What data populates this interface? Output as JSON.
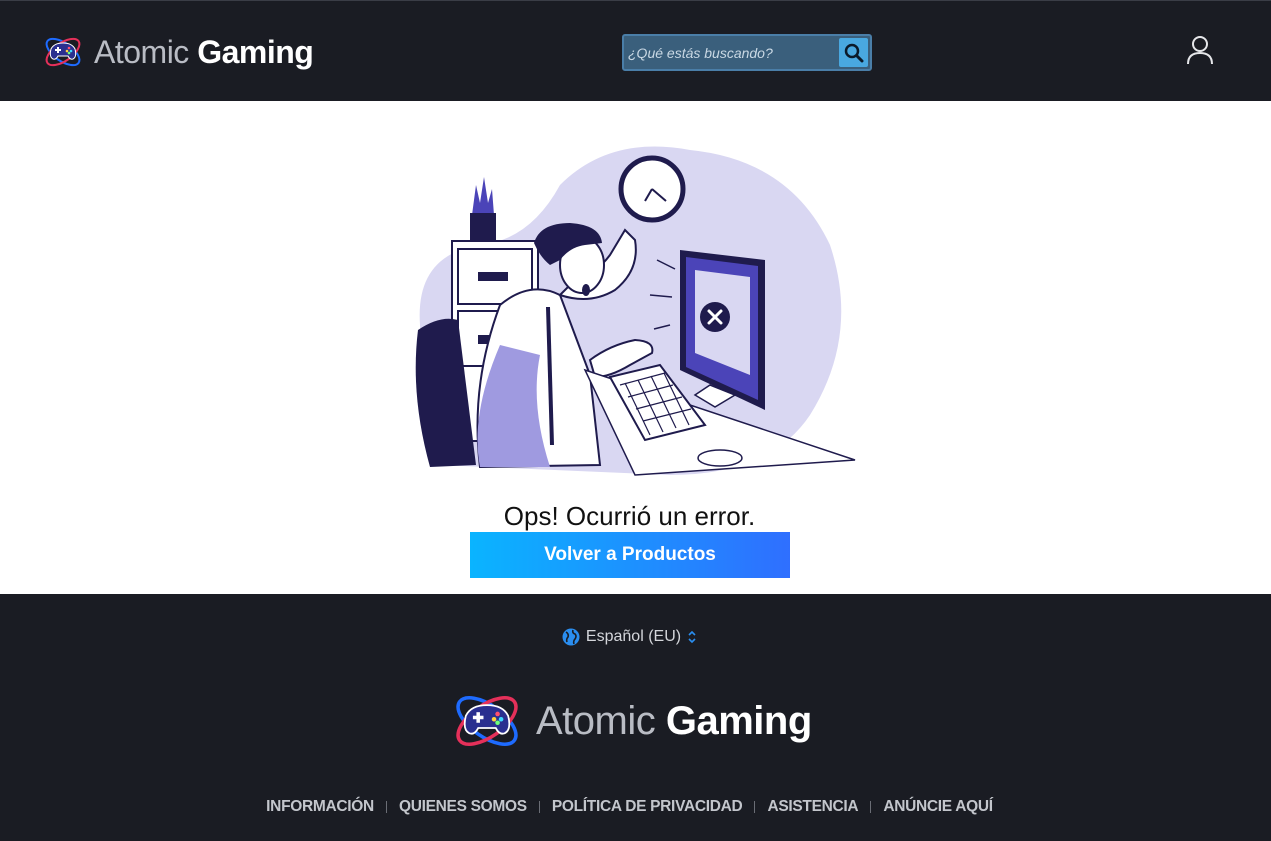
{
  "header": {
    "brand_light": "Atomic",
    "brand_bold": "Gaming",
    "search_placeholder": "¿Qué estás buscando?"
  },
  "main": {
    "error_title": "Ops! Ocurrió un error.",
    "back_button_label": "Volver a Productos"
  },
  "footer": {
    "language": "Español (EU)",
    "brand_light": "Atomic",
    "brand_bold": "Gaming",
    "links": [
      "INFORMACIÓN",
      "QUIENES SOMOS",
      "POLÍTICA DE PRIVACIDAD",
      "ASISTENCIA",
      "ANÚNCIE AQUÍ"
    ]
  },
  "colors": {
    "header_bg": "#1a1c23",
    "button_gradient_start": "#0ab4ff",
    "button_gradient_end": "#2f6fff",
    "illustration_accent": "#4b44b8"
  },
  "icons": [
    "controller-logo-icon",
    "search-icon",
    "user-icon",
    "globe-icon",
    "chevron-updown-icon"
  ]
}
